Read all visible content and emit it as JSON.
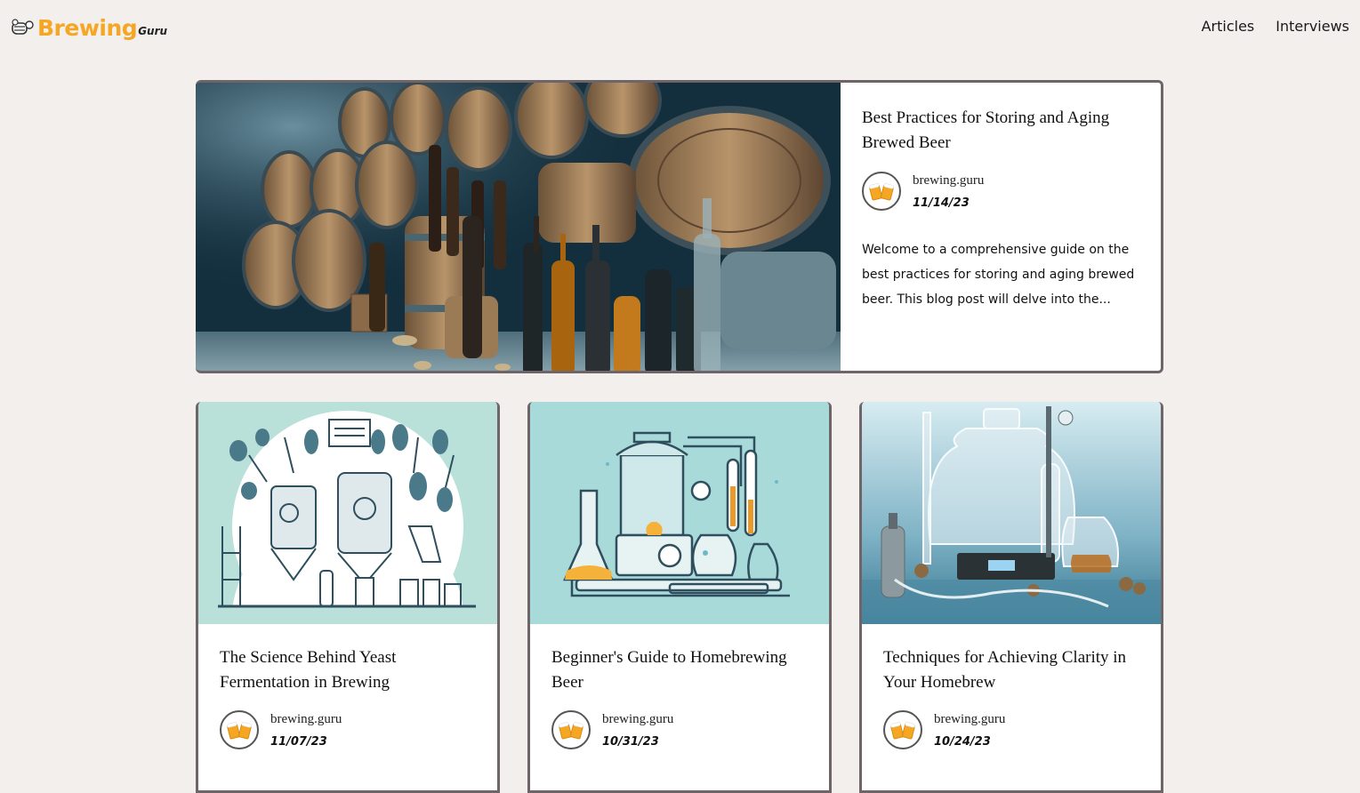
{
  "header": {
    "logo_main": "Brewing",
    "logo_sub": "Guru",
    "nav": [
      {
        "label": "Articles"
      },
      {
        "label": "Interviews"
      }
    ]
  },
  "featured": {
    "title": "Best Practices for Storing and Aging Brewed Beer",
    "author": "brewing.guru",
    "date": "11/14/23",
    "excerpt": "Welcome to a comprehensive guide on the best practices for storing and aging brewed beer. This blog post will delve into the..."
  },
  "cards": [
    {
      "title": "The Science Behind Yeast Fermentation in Brewing",
      "author": "brewing.guru",
      "date": "11/07/23"
    },
    {
      "title": "Beginner's Guide to Homebrewing Beer",
      "author": "brewing.guru",
      "date": "10/31/23"
    },
    {
      "title": "Techniques for Achieving Clarity in Your Homebrew",
      "author": "brewing.guru",
      "date": "10/24/23"
    }
  ],
  "colors": {
    "background": "#f3efed",
    "brand": "#f5a623",
    "card_border": "#6f6468",
    "card_bg": "#ffffff"
  },
  "icons": {
    "logo": "beer-barrel-icon",
    "avatar": "beer-mugs-cheers-icon"
  }
}
